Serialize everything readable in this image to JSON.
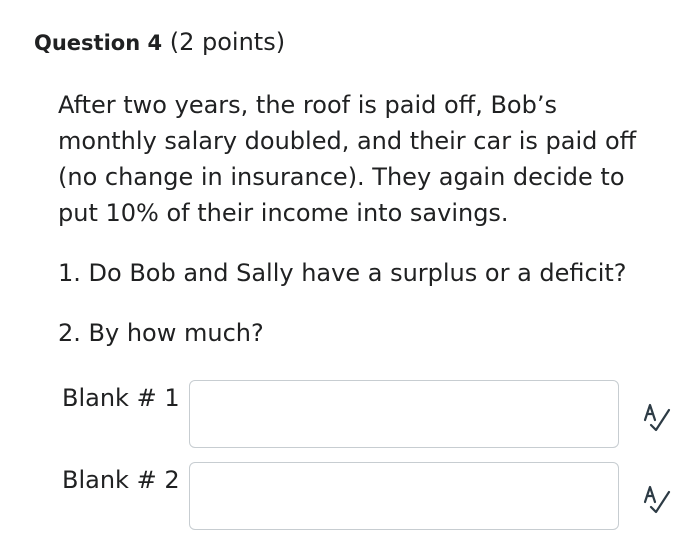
{
  "question": {
    "title": "Question 4",
    "points": "(2 points)"
  },
  "prompt": {
    "lines": [
      "After two years, the roof is paid off, Bob’s",
      "monthly salary doubled, and their car is paid off",
      "(no change in insurance). They again decide to",
      "put 10% of their income into savings."
    ],
    "item1": "1. Do Bob and Sally have a surplus or a deficit?",
    "item2": "2. By how much?"
  },
  "blanks": [
    {
      "label": "Blank # 1",
      "value": "",
      "icon": "spellcheck-icon"
    },
    {
      "label": "Blank # 2",
      "value": "",
      "icon": "spellcheck-icon"
    }
  ]
}
